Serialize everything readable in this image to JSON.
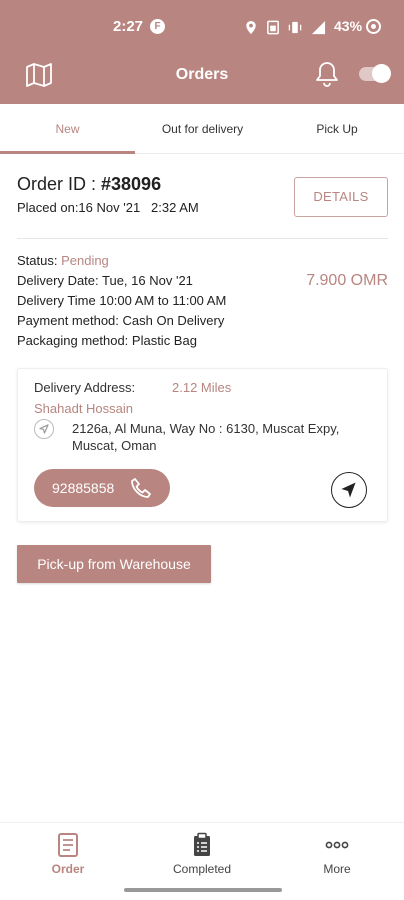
{
  "status_bar": {
    "time": "2:27",
    "app_glyph": "F",
    "battery": "43%",
    "icons": [
      "location-icon",
      "sim-card-icon",
      "vibrate-icon",
      "signal-icon",
      "battery-icon"
    ]
  },
  "app_bar": {
    "title": "Orders",
    "left_icon": "map-icon",
    "right_icons": [
      "bell-icon",
      "toggle-switch"
    ]
  },
  "tabs": [
    {
      "label": "New",
      "active": true
    },
    {
      "label": "Out for delivery",
      "active": false
    },
    {
      "label": "Pick Up",
      "active": false
    }
  ],
  "order": {
    "id_label": "Order ID : ",
    "id_value": "#38096",
    "placed_on": "Placed on:16 Nov '21   2:32 AM",
    "details_label": "DETAILS",
    "status_label": "Status: ",
    "status_value": "Pending",
    "delivery_date": "Delivery Date: Tue, 16 Nov '21",
    "delivery_time": "Delivery Time 10:00 AM to 11:00 AM",
    "payment_method": "Payment method: Cash On Delivery",
    "packaging_method": "Packaging method: Plastic Bag",
    "amount": "7.900 OMR"
  },
  "address_card": {
    "label": "Delivery Address:",
    "distance": "2.12 Miles",
    "name": "Shahadt Hossain",
    "address": "2126a, Al Muna, Way No : 6130, Muscat Expy, Muscat, Oman",
    "phone": "92885858"
  },
  "actions": {
    "pickup_label": "Pick-up from Warehouse"
  },
  "bottom_nav": [
    {
      "label": "Order",
      "icon": "order-list-icon",
      "active": true
    },
    {
      "label": "Completed",
      "icon": "clipboard-icon",
      "active": false
    },
    {
      "label": "More",
      "icon": "more-dots-icon",
      "active": false
    }
  ],
  "colors": {
    "accent": "#b88580",
    "background": "#ffffff",
    "text": "#222222"
  }
}
